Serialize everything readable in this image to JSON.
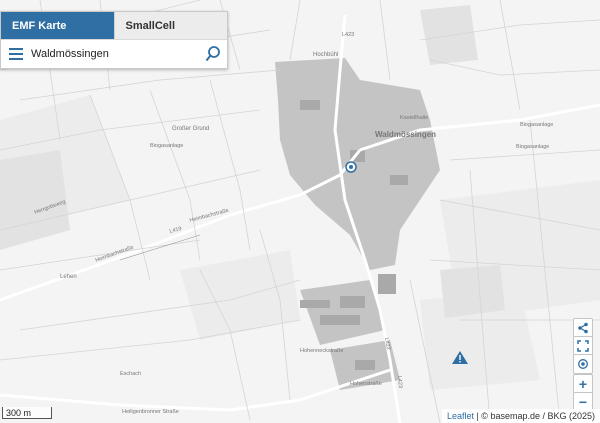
{
  "tabs": [
    {
      "label": "EMF Karte",
      "active": true
    },
    {
      "label": "SmallCell",
      "active": false
    }
  ],
  "search": {
    "value": "Waldmössingen",
    "placeholder": ""
  },
  "map_labels": {
    "town": "Waldmössingen",
    "hochbuhl": "Hochbühl",
    "grosser_grund": "Großer Grund",
    "biogas_west": "Biogasanlage",
    "biogas_east1": "Biogasanlage",
    "biogas_east2": "Biogasanlage",
    "kastellhalle": "Kastellhalle",
    "heimbachstrasse": "Heimbachstraße",
    "heimbachstrasse2": "Heimbachstraße",
    "l419": "L419",
    "l423": "L423",
    "l422": "L422",
    "l423b": "L423",
    "lehen": "Lehen",
    "herrgottsweg": "Herrgottsweg",
    "hoheneckstrasse": "Hohenneckstraße",
    "hohenstrasse": "Hohenstraße",
    "heiligenbronner": "Heiligenbronner Straße",
    "eschach": "Eschach"
  },
  "scale_label": "300 m",
  "attribution": {
    "link": "Leaflet",
    "text": " | © basemap.de / BKG (2025)"
  },
  "controls": [
    "share-icon",
    "fullscreen-icon",
    "locate-icon",
    "zoom-in-icon",
    "zoom-out-icon"
  ],
  "colors": {
    "accent": "#2f6fa3",
    "warning": "#2f6fa3",
    "built_area": "#bcbcbc"
  }
}
